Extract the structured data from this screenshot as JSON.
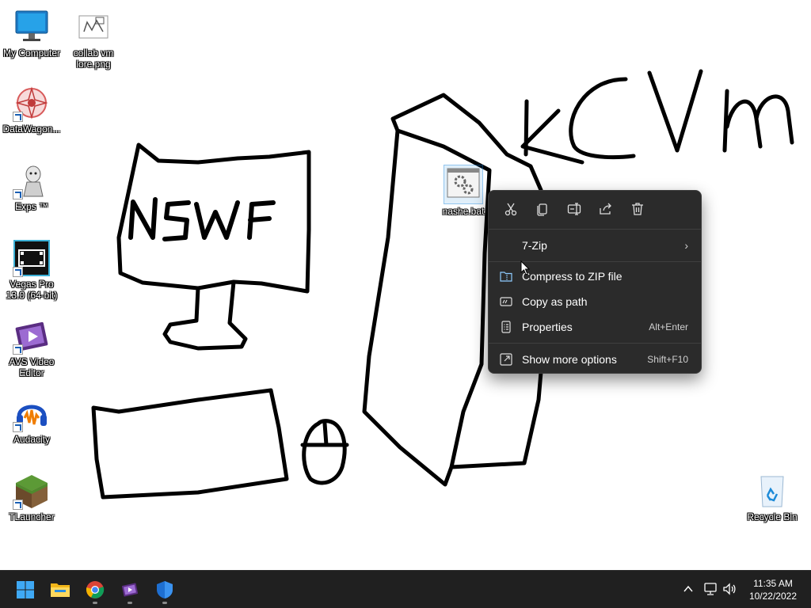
{
  "desktop": {
    "drawing_text": [
      "NSWF",
      "kCVM"
    ],
    "icons": [
      {
        "label": "My Computer"
      },
      {
        "label": "collab vm lore.png"
      },
      {
        "label": "DataWagon..."
      },
      {
        "label": "Exps ™"
      },
      {
        "label": "Vegas Pro 13.0 (64-bit)"
      },
      {
        "label": "AVS Video Editor"
      },
      {
        "label": "Audacity"
      },
      {
        "label": "TLauncher"
      },
      {
        "label": "nashe.bat"
      },
      {
        "label": "Recycle Bin"
      }
    ]
  },
  "context_menu": {
    "quick_actions": [
      "cut-icon",
      "copy-icon",
      "rename-icon",
      "share-icon",
      "delete-icon"
    ],
    "items": [
      {
        "label": "7-Zip",
        "accel": "",
        "submenu": true
      },
      {
        "label": "Compress to ZIP file",
        "accel": ""
      },
      {
        "label": "Copy as path",
        "accel": ""
      },
      {
        "label": "Properties",
        "accel": "Alt+Enter"
      },
      {
        "label": "Show more options",
        "accel": "Shift+F10"
      }
    ]
  },
  "taskbar": {
    "apps": [
      "start-icon",
      "file-explorer-icon",
      "chrome-icon",
      "video-editor-icon",
      "windows-security-icon"
    ],
    "clock": {
      "time": "11:35 AM",
      "date": "10/22/2022"
    }
  },
  "colors": {
    "menu_bg": "#2b2b2b",
    "taskbar_bg": "#202020",
    "accent": "#0078d4"
  }
}
